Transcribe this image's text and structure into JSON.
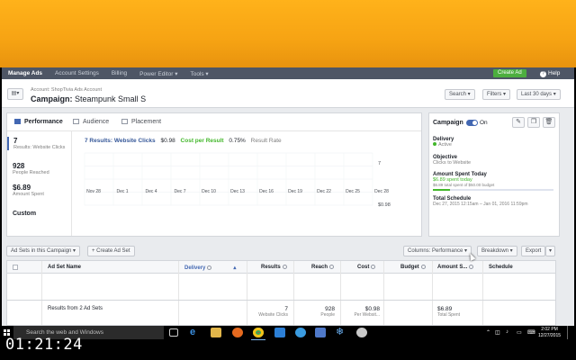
{
  "banner": {
    "color": "#f6a313"
  },
  "topnav": {
    "items": [
      "Manage Ads",
      "Account Settings",
      "Billing",
      "Power Editor ▾",
      "Tools ▾"
    ],
    "create_ad": "Create Ad",
    "help": "Help"
  },
  "campaign_header": {
    "account": "Account: ShopTivia Ads Account",
    "label": "Campaign:",
    "name": "Steampunk Small S",
    "search": "Search ▾",
    "filters": "Filters ▾",
    "date_range": "Last 30 days ▾"
  },
  "performance": {
    "tabs": [
      "Performance",
      "Audience",
      "Placement"
    ],
    "stats": [
      {
        "value": "7",
        "label": "Results: Website Clicks"
      },
      {
        "value": "928",
        "label": "People Reached"
      },
      {
        "value": "$6.89",
        "label": "Amount Spent"
      }
    ],
    "custom": "Custom",
    "summary": {
      "results": "7 Results: Website Clicks",
      "cpr_value": "$0.98",
      "cpr_label": "Cost per Result",
      "rate_value": "0.75%",
      "rate_label": "Result Rate"
    },
    "axis_top": "7",
    "axis_bottom": "$0.98"
  },
  "chart_data": {
    "type": "line",
    "categories": [
      "Nov 28",
      "Dec 1",
      "Dec 4",
      "Dec 7",
      "Dec 10",
      "Dec 13",
      "Dec 16",
      "Dec 19",
      "Dec 22",
      "Dec 25",
      "Dec 28"
    ],
    "series": [],
    "grid": true
  },
  "side": {
    "title": "Campaign",
    "on_label": "On",
    "delivery_label": "Delivery",
    "delivery_value": "Active",
    "objective_label": "Objective",
    "objective_value": "Clicks to Website",
    "spent_label": "Amount Spent Today",
    "spent_value": "$6.89 spent today",
    "spent_budget": "$6.89 total spent of $50.00 budget",
    "budget_progress": 0.14,
    "schedule_label": "Total Schedule",
    "schedule_value": "Dec 27, 2015 12:15am – Jan 01, 2016 11:59pm",
    "accent": "#4267b2"
  },
  "adsets": {
    "dropdown": "Ad Sets in this Campaign ▾",
    "create": "+ Create Ad Set",
    "columns": "Columns: Performance ▾",
    "breakdown": "Breakdown ▾",
    "export": "Export",
    "headers": [
      "Ad Set Name",
      "Delivery",
      "Results",
      "Reach",
      "Cost",
      "Budget",
      "Amount S...",
      "Schedule"
    ],
    "total_label": "Results from 2 Ad Sets",
    "totals": {
      "results": "7",
      "results_sub": "Website Clicks",
      "reach": "928",
      "reach_sub": "People",
      "cost": "$0.98",
      "cost_sub": "Per Websit...",
      "spent": "$6.89",
      "spent_sub": "Total Spent"
    }
  },
  "taskbar": {
    "search_placeholder": "Search the web and Windows",
    "clock_time": "2:02 PM",
    "clock_date": "12/27/2015"
  },
  "timer": "01:21:24"
}
